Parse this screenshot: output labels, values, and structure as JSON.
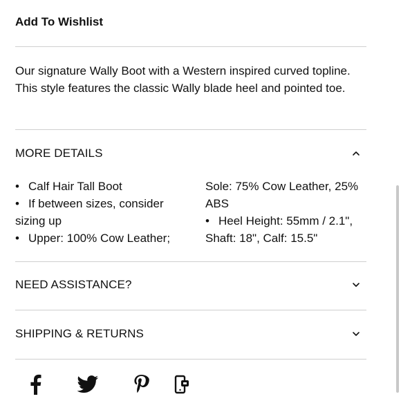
{
  "wishlist": {
    "label": "Add To Wishlist"
  },
  "description": "Our signature Wally Boot with a Western inspired curved topline. This style features the classic Wally blade heel and pointed toe.",
  "more_details": {
    "title": "MORE DETAILS",
    "expanded": true,
    "left_column": {
      "item1": "Calf Hair Tall Boot",
      "item2": "If between sizes, consider",
      "item2_cont": "sizing up",
      "item3": "Upper: 100% Cow Leather;"
    },
    "right_column": {
      "line1": "Sole: 75% Cow Leather, 25%",
      "line2": "ABS",
      "item4": "Heel Height: 55mm / 2.1\",",
      "item4_cont": "Shaft: 18\", Calf: 15.5\""
    },
    "bullet": "•"
  },
  "need_assistance": {
    "title": "NEED ASSISTANCE?",
    "expanded": false
  },
  "shipping_returns": {
    "title": "SHIPPING & RETURNS",
    "expanded": false
  },
  "share": [
    {
      "icon": "facebook-icon"
    },
    {
      "icon": "twitter-icon"
    },
    {
      "icon": "pinterest-icon"
    },
    {
      "icon": "share-phone-icon"
    }
  ],
  "colors": {
    "text": "#111111",
    "divider": "#cfcfcf",
    "background": "#ffffff"
  }
}
